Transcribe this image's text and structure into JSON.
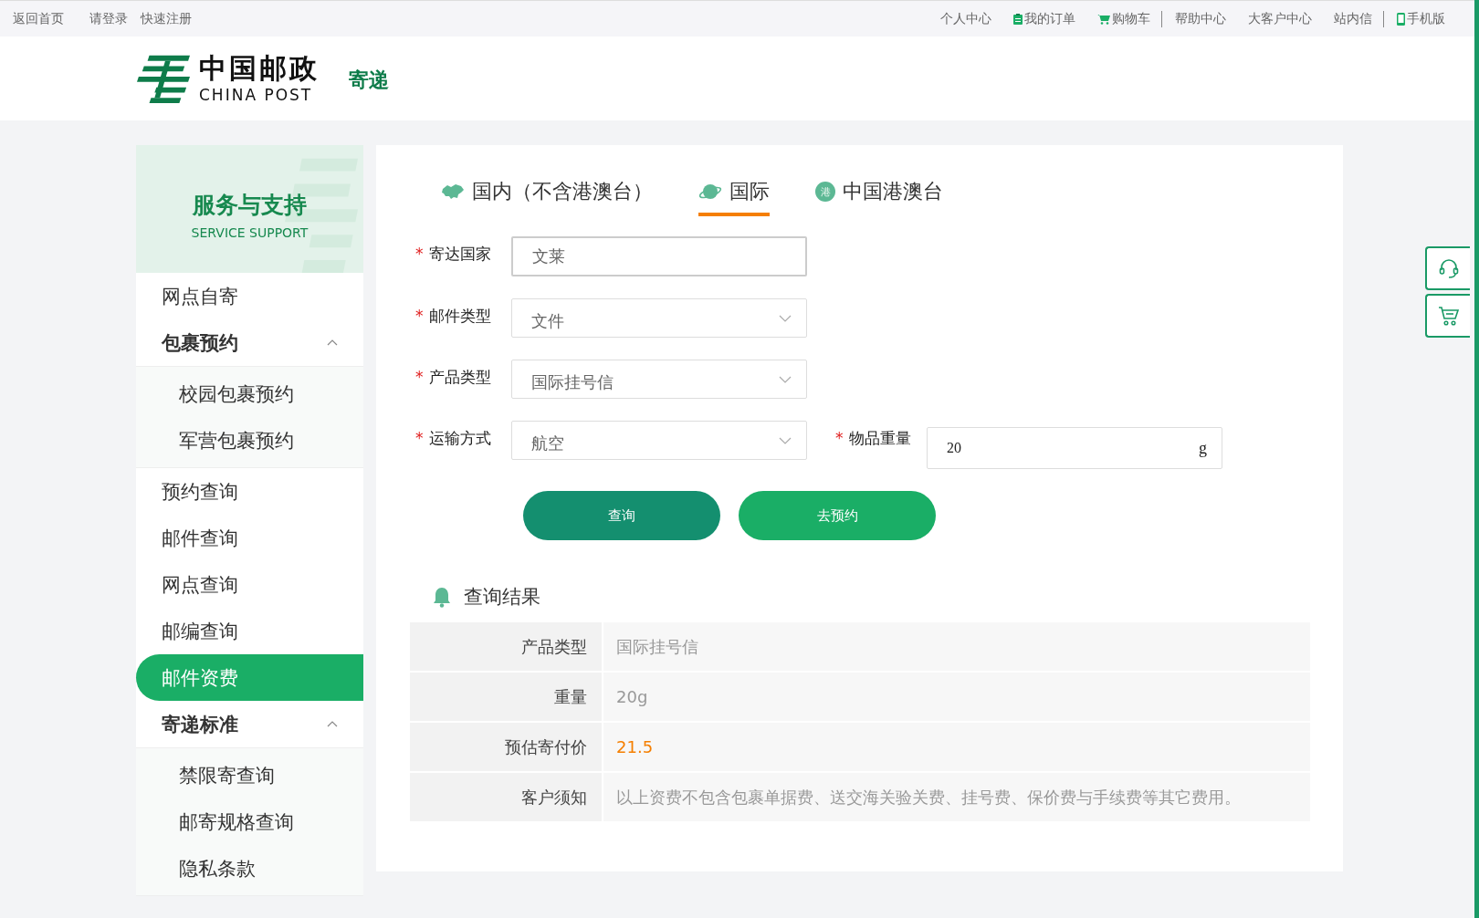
{
  "top_bar": {
    "left_links": [
      "返回首页",
      "请登录",
      "快速注册"
    ],
    "right_links": [
      {
        "label": "个人中心",
        "has_icon": false,
        "divider_before": false
      },
      {
        "label": "我的订单",
        "has_icon": true,
        "divider_before": false
      },
      {
        "label": "购物车",
        "has_icon": true,
        "divider_before": false
      },
      {
        "label": "帮助中心",
        "has_icon": false,
        "divider_before": true
      },
      {
        "label": "大客户中心",
        "has_icon": false,
        "divider_before": false
      },
      {
        "label": "站内信",
        "has_icon": false,
        "divider_before": false
      },
      {
        "label": "手机版",
        "has_icon": true,
        "divider_before": true
      }
    ]
  },
  "header": {
    "logo_cn": "中国邮政",
    "logo_en": "CHINA POST",
    "section": "寄递"
  },
  "sidebar": {
    "title": "服务与支持",
    "subtitle": "SERVICE SUPPORT",
    "items": [
      {
        "label": "网点自寄",
        "selected": false
      },
      {
        "label": "包裹预约",
        "selected": false,
        "expanded": true,
        "children": [
          {
            "label": "校园包裹预约",
            "selected": false
          },
          {
            "label": "军营包裹预约",
            "selected": false
          }
        ]
      },
      {
        "label": "预约查询",
        "selected": false
      },
      {
        "label": "邮件查询",
        "selected": false
      },
      {
        "label": "网点查询",
        "selected": false
      },
      {
        "label": "邮编查询",
        "selected": false
      },
      {
        "label": "邮件资费",
        "selected": true
      },
      {
        "label": "寄递标准",
        "selected": false,
        "expanded": true,
        "children": [
          {
            "label": "禁限寄查询",
            "selected": false
          },
          {
            "label": "邮寄规格查询",
            "selected": false
          },
          {
            "label": "隐私条款",
            "selected": false
          }
        ]
      }
    ]
  },
  "tabs": [
    {
      "label": "国内（不含港澳台）",
      "selected": false,
      "kind": "map"
    },
    {
      "label": "国际",
      "selected": true,
      "kind": "planet"
    },
    {
      "label": "中国港澳台",
      "selected": false,
      "kind": "badge",
      "badge": "港"
    }
  ],
  "form": {
    "fields": [
      {
        "label": "寄达国家",
        "required_mark": "*",
        "kind": "input",
        "value": "文莱"
      },
      {
        "label": "邮件类型",
        "required_mark": "*",
        "kind": "select",
        "value": "文件"
      },
      {
        "label": "产品类型",
        "required_mark": "*",
        "kind": "select",
        "value": "国际挂号信"
      },
      {
        "label": "运输方式",
        "required_mark": "*",
        "kind": "select",
        "value": "航空"
      }
    ],
    "weight": {
      "label": "物品重量",
      "required_mark": "*",
      "value": "20",
      "unit": "g"
    },
    "buttons": [
      {
        "label": "查询",
        "kind": "primary"
      },
      {
        "label": "去预约",
        "kind": "secondary"
      }
    ]
  },
  "results": {
    "title": "查询结果",
    "rows": [
      {
        "label": "产品类型",
        "value": "国际挂号信",
        "highlight": false
      },
      {
        "label": "重量",
        "value": "20g",
        "highlight": false
      },
      {
        "label": "预估寄付价",
        "value": "21.5",
        "highlight": true
      },
      {
        "label": "客户须知",
        "value": "以上资费不包含包裹单据费、送交海关验关费、挂号费、保价费与手续费等其它费用。",
        "highlight": false
      }
    ]
  }
}
